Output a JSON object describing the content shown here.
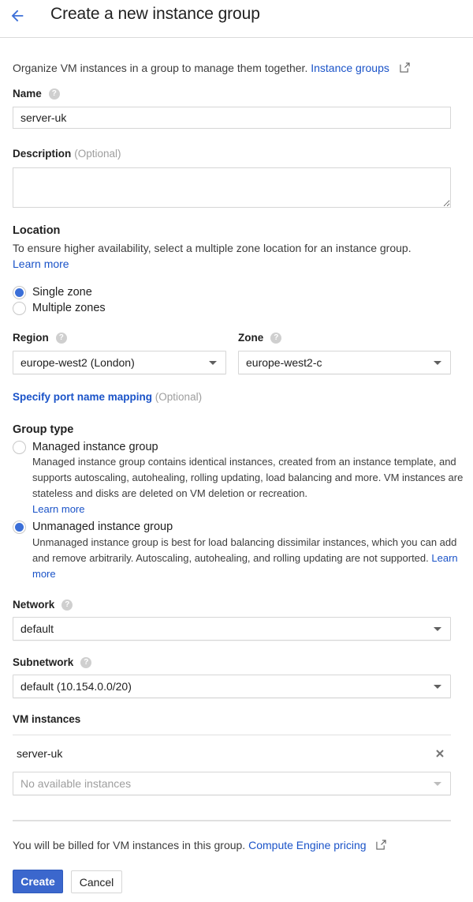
{
  "header": {
    "title": "Create a new instance group",
    "back_icon": "arrow-back-icon"
  },
  "intro": {
    "text": "Organize VM instances in a group to manage them together.",
    "link_label": "Instance groups",
    "link_icon": "external-link-icon"
  },
  "name": {
    "label": "Name",
    "value": "server-uk",
    "help_icon": "help-icon"
  },
  "description": {
    "label": "Description",
    "optional": "(Optional)",
    "value": ""
  },
  "location": {
    "label": "Location",
    "text": "To ensure higher availability, select a multiple zone location for an instance group.",
    "learn_more": "Learn more",
    "options": [
      {
        "label": "Single zone",
        "checked": true
      },
      {
        "label": "Multiple zones",
        "checked": false
      }
    ]
  },
  "region": {
    "label": "Region",
    "value": "europe-west2 (London)"
  },
  "zone": {
    "label": "Zone",
    "value": "europe-west2-c"
  },
  "port_mapping": {
    "link_label": "Specify port name mapping",
    "optional": "(Optional)"
  },
  "group_type": {
    "label": "Group type",
    "options": [
      {
        "label": "Managed instance group",
        "checked": false,
        "description": "Managed instance group contains identical instances, created from an instance template, and supports autoscaling, autohealing, rolling updating, load balancing and more. VM instances are stateless and disks are deleted on VM deletion or recreation.",
        "learn_more": "Learn more"
      },
      {
        "label": "Unmanaged instance group",
        "checked": true,
        "description": "Unmanaged instance group is best for load balancing dissimilar instances, which you can add and remove arbitrarily. Autoscaling, autohealing, and rolling updating are not supported.",
        "learn_more": "Learn more"
      }
    ]
  },
  "network": {
    "label": "Network",
    "value": "default"
  },
  "subnetwork": {
    "label": "Subnetwork",
    "value": "default (10.154.0.0/20)"
  },
  "vm_instances": {
    "label": "VM instances",
    "items": [
      {
        "name": "server-uk"
      }
    ],
    "add_select_placeholder": "No available instances"
  },
  "billing": {
    "text": "You will be billed for VM instances in this group.",
    "link_label": "Compute Engine pricing"
  },
  "actions": {
    "create_label": "Create",
    "cancel_label": "Cancel"
  },
  "colors": {
    "accent": "#3b67cd",
    "link": "#1a53c8",
    "radio_checked": "#3b6fd8"
  }
}
